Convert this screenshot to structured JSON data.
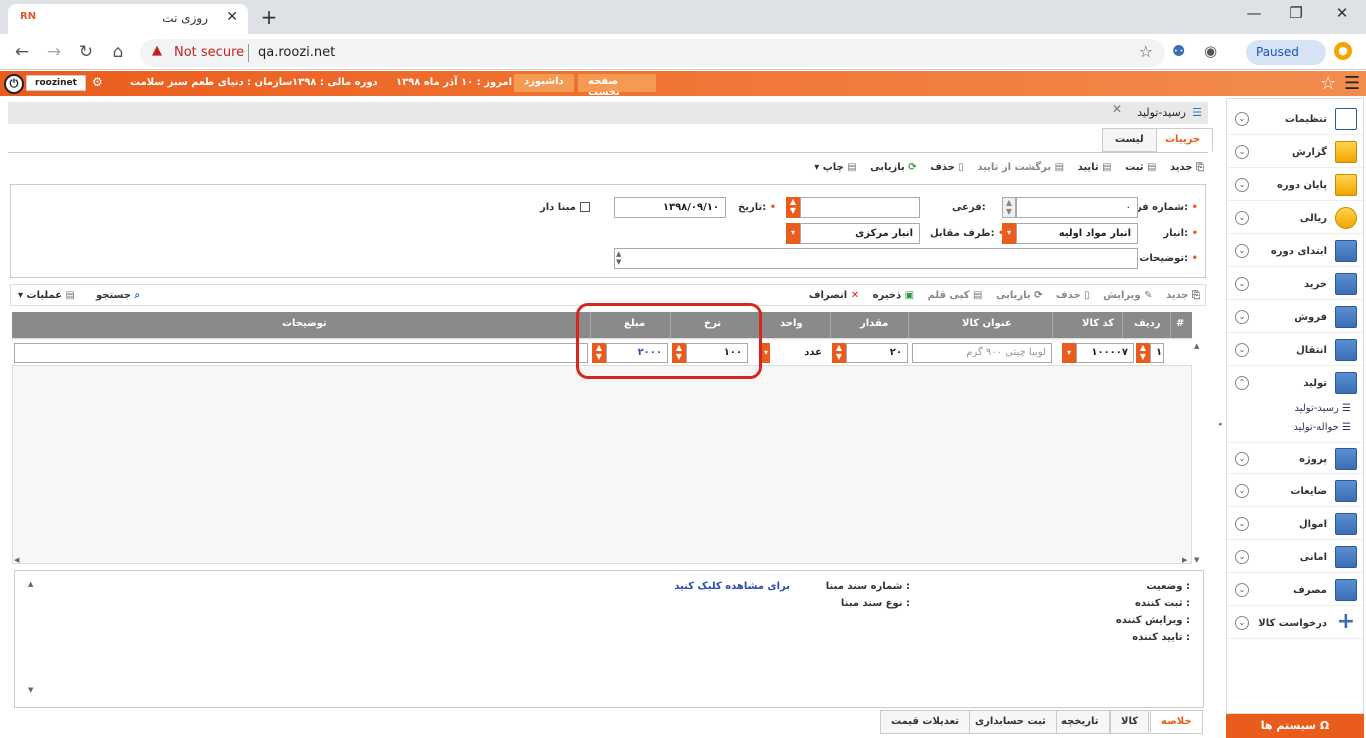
{
  "browser": {
    "tab_title": "روزی نت",
    "favicon": "RN",
    "not_secure": "Not secure",
    "url": "qa.roozi.net",
    "paused": "Paused"
  },
  "appbar": {
    "user": "roozinet",
    "home": "صفحه نخست",
    "dashboard": "داشبورد",
    "today": "امروز :  ۱۰ آذر ماه ۱۳۹۸",
    "fiscal": "دوره مالی :  ۱۳۹۸",
    "org": "سازمان :  دنیای طعم سبز سلامت"
  },
  "sidebar": {
    "items": [
      {
        "label": "تنظیمات"
      },
      {
        "label": "گزارش"
      },
      {
        "label": "پایان دوره"
      },
      {
        "label": "ریالی"
      },
      {
        "label": "ابتدای دوره"
      },
      {
        "label": "خرید"
      },
      {
        "label": "فروش"
      },
      {
        "label": "انتقال"
      },
      {
        "label": "تولید"
      },
      {
        "label": "پروژه"
      },
      {
        "label": "ضایعات"
      },
      {
        "label": "اموال"
      },
      {
        "label": "امانی"
      },
      {
        "label": "مصرف"
      },
      {
        "label": "درخواست کالا"
      }
    ],
    "subitems": [
      "رسید-تولید",
      "حواله-تولید"
    ],
    "system": "سیستم ها"
  },
  "doc": {
    "title": "رسید-تولید",
    "tab_details": "جزییات",
    "tab_list": "لیست"
  },
  "toolbar": {
    "new": "جدید",
    "save": "ثبت",
    "confirm": "تایید",
    "unconfirm": "برگشت از تایید",
    "delete": "حذف",
    "refresh": "بازیابی",
    "print": "چاپ"
  },
  "form": {
    "form_no_label": "شماره فرم:",
    "form_no": "۰",
    "sub_label": "فرعی:",
    "date_label": "تاریخ:",
    "date": "۱۳۹۸/۰۹/۱۰",
    "has_base": "مبنا دار",
    "warehouse_label": "انبار:",
    "warehouse": "انبار مواد اولیه",
    "party_label": "طرف مقابل:",
    "party": "انبار مرکزی",
    "desc_label": "توضیحات:"
  },
  "gridtoolbar": {
    "new": "جدید",
    "edit": "ویرایش",
    "delete": "حذف",
    "refresh": "بازیابی",
    "copy": "کپی قلم",
    "save": "ذخیره",
    "cancel": "انصراف",
    "search": "جستجو",
    "ops": "عملیات"
  },
  "grid": {
    "headers": [
      "#",
      "ردیف",
      "کد کالا",
      "عنوان کالا",
      "مقدار",
      "واحد",
      "نرخ",
      "مبلغ",
      "توضیحات"
    ],
    "row": {
      "no": "۱",
      "code": "۱۰۰۰۰۷",
      "name": "لوبیا چیتی ۹۰۰ گرم",
      "qty": "۲۰",
      "unit": "عدد",
      "rate": "۱۰۰",
      "amount": "۲۰۰۰"
    }
  },
  "info": {
    "status": "وضعیت :",
    "created_by": "ثبت کننده :",
    "edited_by": "ویرایش کننده :",
    "confirmed_by": "تایید کننده :",
    "base_no": "شماره سند مبنا :",
    "base_type": "نوع سند مبنا :",
    "view_link": "برای مشاهده کلیک کنید"
  },
  "bottomtabs": [
    "خلاصه",
    "کالا",
    "تاریخچه",
    "ثبت حسابداری",
    "تعدیلات قیمت"
  ]
}
